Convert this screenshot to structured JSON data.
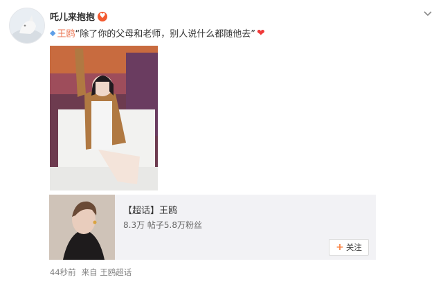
{
  "post": {
    "username": "吒儿来抱抱",
    "user_badge_icon": "vip-emoji-icon",
    "topic_name": "王鸥",
    "text_body": "“除了你的父母和老师，别人说什么都随他去”",
    "heart_icon": "❤",
    "image_alt": "photo"
  },
  "supertopic_card": {
    "title": "【超话】王鸥",
    "stats": "8.3万 帖子5.8万粉丝",
    "follow_label": "关注"
  },
  "meta": {
    "time": "44秒前",
    "source_prefix": "来自",
    "source_name": "王鸥超话"
  },
  "colors": {
    "accent_orange": "#eb7350",
    "follow_plus": "#fa7d3c",
    "heart": "#f03a3a",
    "card_bg": "#f2f2f5"
  }
}
